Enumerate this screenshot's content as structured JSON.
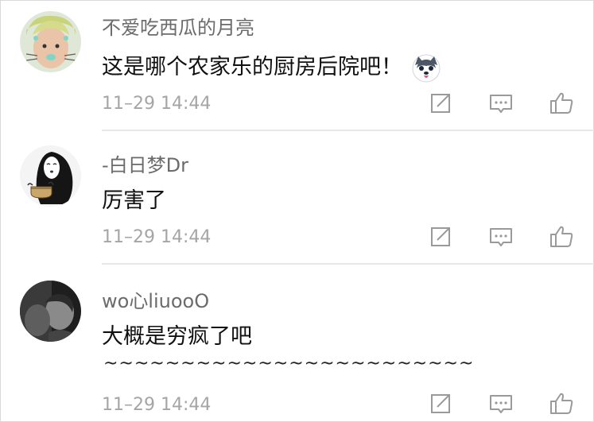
{
  "comments": [
    {
      "username": "不爱吃西瓜的月亮",
      "text": "这是哪个农家乐的厨房后院吧！",
      "emoji": "husky-face-emoji",
      "time": "11–29 14:44"
    },
    {
      "username": "-白日梦Dr",
      "text": "厉害了",
      "time": "11–29 14:44"
    },
    {
      "username": "wo心liuooO",
      "text": "大概是穷疯了吧",
      "text_line2": "~~~~~~~~~~~~~~~~~~~~~~~~",
      "time": "11–29 14:44"
    }
  ],
  "icons": {
    "share": "share-icon",
    "reply": "comment-icon",
    "like": "thumbs-up-icon"
  },
  "colors": {
    "username": "#6b6b6b",
    "text": "#111111",
    "time": "#a5a5a5",
    "icon": "#9a9a9a",
    "divider": "#e8e8e8"
  }
}
